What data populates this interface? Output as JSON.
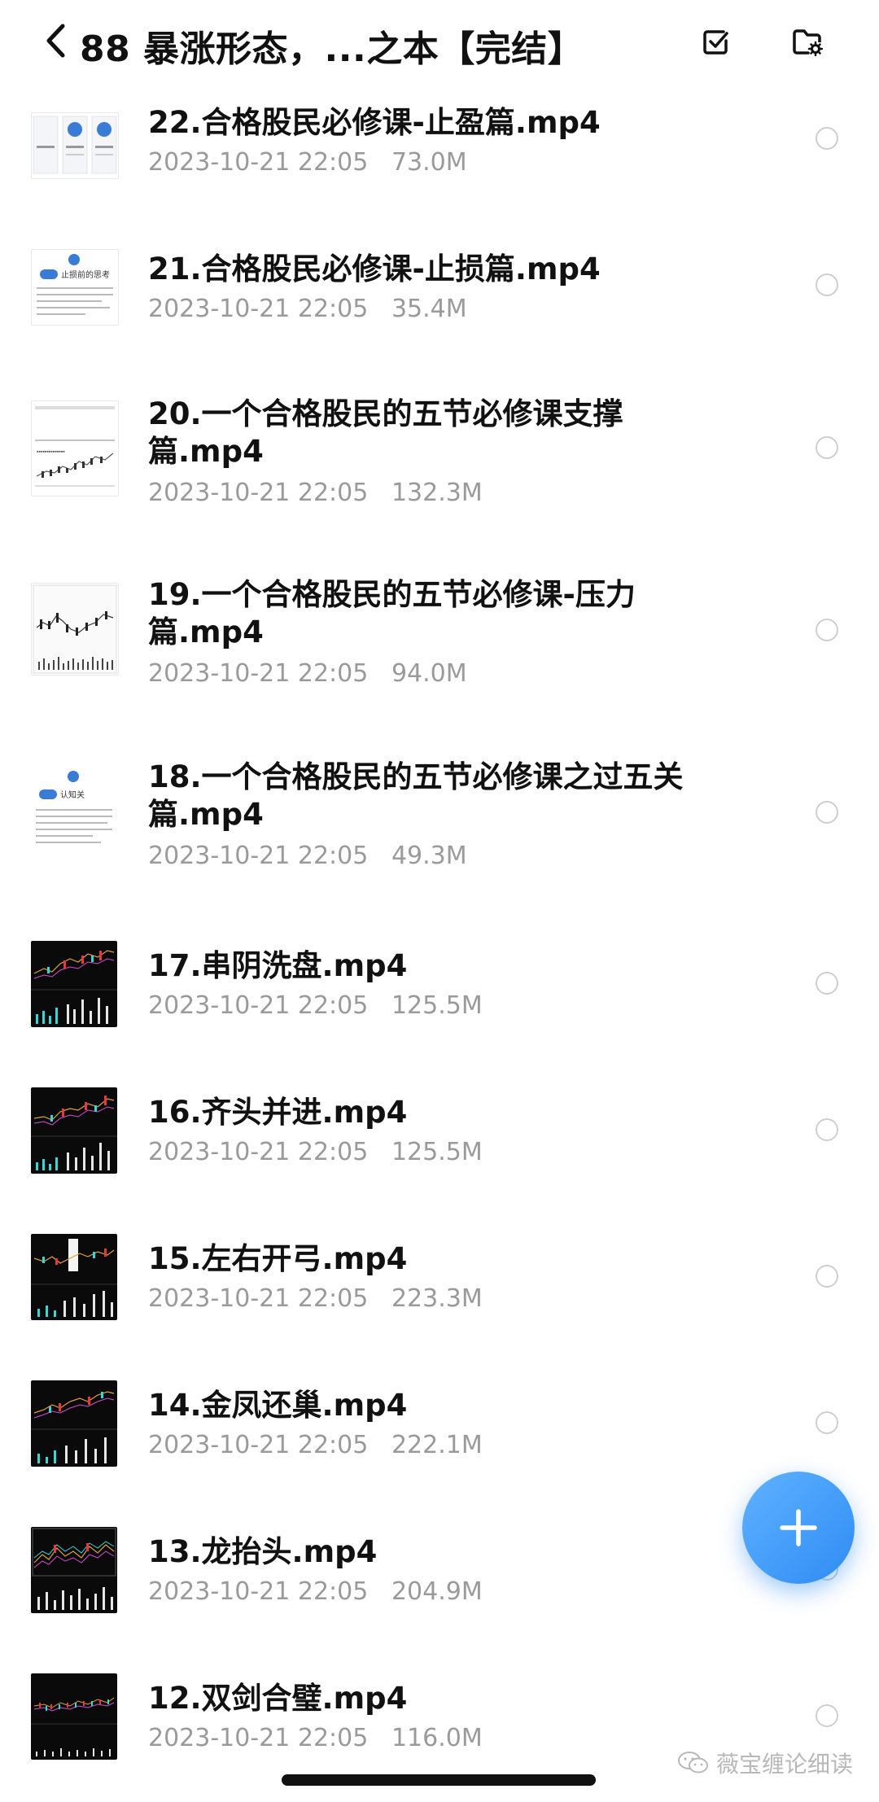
{
  "header": {
    "title": "88 暴涨形态，...之本【完结】",
    "back_icon": "chevron-left-icon",
    "select_icon": "checkbox-icon",
    "folder_settings_icon": "folder-settings-icon"
  },
  "items": [
    {
      "name": "22.合格股民必修课-止盈篇.mp4",
      "date": "2023-10-21 22:05",
      "size": "73.0M",
      "thumb": "light-slides"
    },
    {
      "name": "21.合格股民必修课-止损篇.mp4",
      "date": "2023-10-21 22:05",
      "size": "35.4M",
      "thumb": "light-doc",
      "thumb_caption": "止损前的思考"
    },
    {
      "name": "20.一个合格股民的五节必修课支撑篇.mp4",
      "date": "2023-10-21 22:05",
      "size": "132.3M",
      "thumb": "light-chart"
    },
    {
      "name": "19.一个合格股民的五节必修课-压力篇.mp4",
      "date": "2023-10-21 22:05",
      "size": "94.0M",
      "thumb": "light-chart"
    },
    {
      "name": "18.一个合格股民的五节必修课之过五关篇.mp4",
      "date": "2023-10-21 22:05",
      "size": "49.3M",
      "thumb": "light-doc",
      "thumb_caption": "认知关"
    },
    {
      "name": "17.串阴洗盘.mp4",
      "date": "2023-10-21 22:05",
      "size": "125.5M",
      "thumb": "dark-chart"
    },
    {
      "name": "16.齐头并进.mp4",
      "date": "2023-10-21 22:05",
      "size": "125.5M",
      "thumb": "dark-chart"
    },
    {
      "name": "15.左右开弓.mp4",
      "date": "2023-10-21 22:05",
      "size": "223.3M",
      "thumb": "dark-chart"
    },
    {
      "name": "14.金凤还巢.mp4",
      "date": "2023-10-21 22:05",
      "size": "222.1M",
      "thumb": "dark-chart"
    },
    {
      "name": "13.龙抬头.mp4",
      "date": "2023-10-21 22:05",
      "size": "204.9M",
      "thumb": "dark-chart"
    },
    {
      "name": "12.双剑合璧.mp4",
      "date": "2023-10-21 22:05",
      "size": "116.0M",
      "thumb": "dark-chart"
    }
  ],
  "fab": {
    "icon": "plus-icon",
    "color": "#3a95f7"
  },
  "watermark": {
    "text": "薇宝缠论细读",
    "icon": "wechat-icon"
  },
  "colors": {
    "accent": "#3a95f7",
    "meta_text": "#9a9a9a",
    "radio_border": "#cfcfcf"
  }
}
